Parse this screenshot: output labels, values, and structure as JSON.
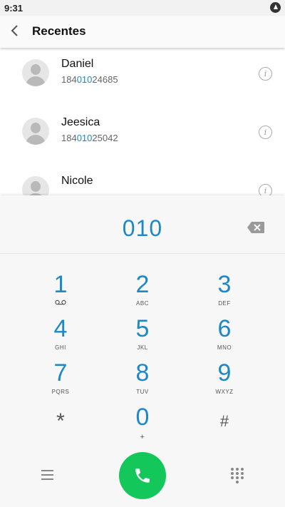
{
  "status": {
    "time": "9:31",
    "icon": "power-icon"
  },
  "header": {
    "title": "Recentes",
    "back_icon": "back-arrow-icon"
  },
  "contacts": [
    {
      "name": "Daniel",
      "number_prefix": "184",
      "number_match": "010",
      "number_suffix": "24685"
    },
    {
      "name": "Jeesica",
      "number_prefix": "184",
      "number_match": "010",
      "number_suffix": "25042"
    },
    {
      "name": "Nicole",
      "number_prefix": "",
      "number_match": "",
      "number_suffix": ""
    }
  ],
  "dialer": {
    "input": "010",
    "keys": [
      {
        "digit": "1",
        "letters": ""
      },
      {
        "digit": "2",
        "letters": "ABC"
      },
      {
        "digit": "3",
        "letters": "DEF"
      },
      {
        "digit": "4",
        "letters": "GHI"
      },
      {
        "digit": "5",
        "letters": "JKL"
      },
      {
        "digit": "6",
        "letters": "MNO"
      },
      {
        "digit": "7",
        "letters": "PQRS"
      },
      {
        "digit": "8",
        "letters": "TUV"
      },
      {
        "digit": "9",
        "letters": "WXYZ"
      },
      {
        "digit": "*",
        "letters": ""
      },
      {
        "digit": "0",
        "letters": "+"
      },
      {
        "digit": "#",
        "letters": ""
      }
    ]
  },
  "colors": {
    "accent": "#1e88c7",
    "call": "#13c75a"
  }
}
